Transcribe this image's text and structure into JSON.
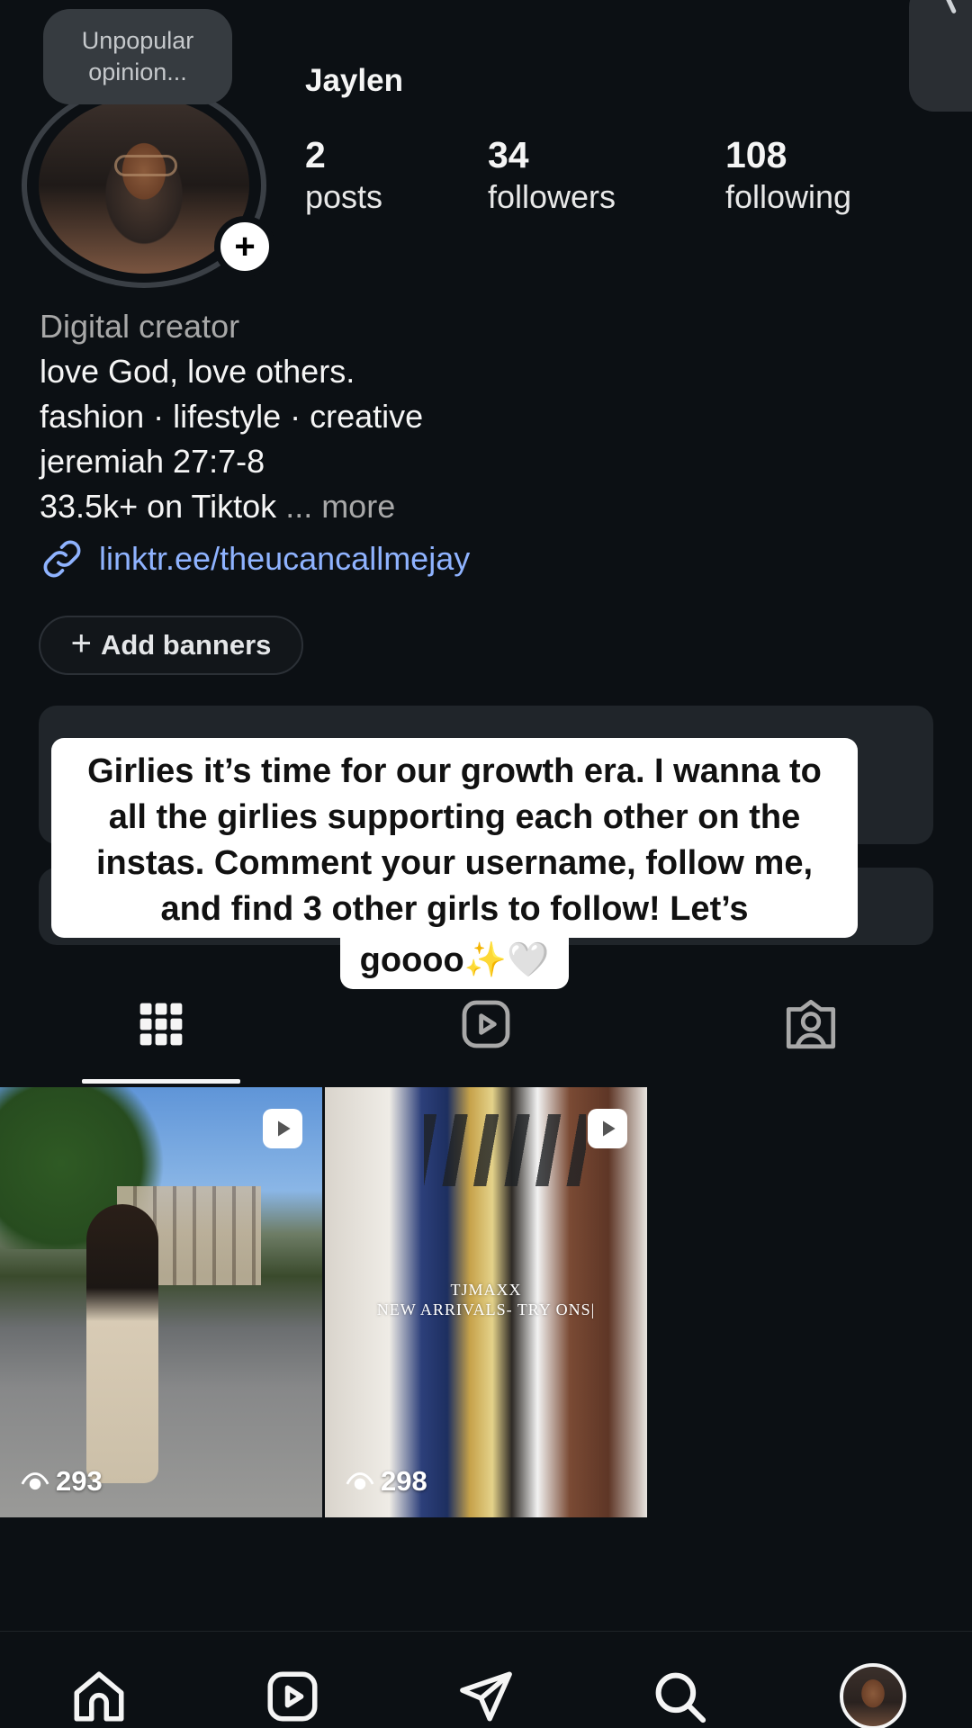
{
  "profile": {
    "note": "Unpopular opinion...",
    "username": "Jaylen",
    "stats": [
      {
        "value": "2",
        "label": "posts"
      },
      {
        "value": "34",
        "label": "followers"
      },
      {
        "value": "108",
        "label": "following"
      }
    ]
  },
  "bio": {
    "category": "Digital creator",
    "lines": [
      "love God, love others.",
      "fashion · lifestyle · creative",
      "jeremiah 27:7-8",
      "33.5k+ on Tiktok"
    ],
    "more": "... more",
    "link": "linktr.ee/theucancallmejay"
  },
  "add_banners": {
    "plus": "+",
    "label": "Add banners"
  },
  "caption": {
    "main": "Girlies it’s time for our growth era. I wanna to all the girlies supporting each other on the instas. Comment your username, follow me, and find 3 other girls to follow! Let’s",
    "tail": "goooo✨🤍"
  },
  "tabs": [
    {
      "icon": "grid-icon",
      "active": true
    },
    {
      "icon": "reels-icon",
      "active": false
    },
    {
      "icon": "tagged-icon",
      "active": false
    }
  ],
  "posts": [
    {
      "views": "293",
      "overlay": ""
    },
    {
      "views": "298",
      "overlay_line1": "TJMAXX",
      "overlay_line2": "NEW ARRIVALS- TRY ONS|"
    }
  ],
  "nav": [
    "home-icon",
    "reels-icon",
    "messages-icon",
    "search-icon",
    "profile-avatar"
  ],
  "colors": {
    "background": "#0c1014",
    "link": "#8fb3ff",
    "panel": "#20252a"
  }
}
